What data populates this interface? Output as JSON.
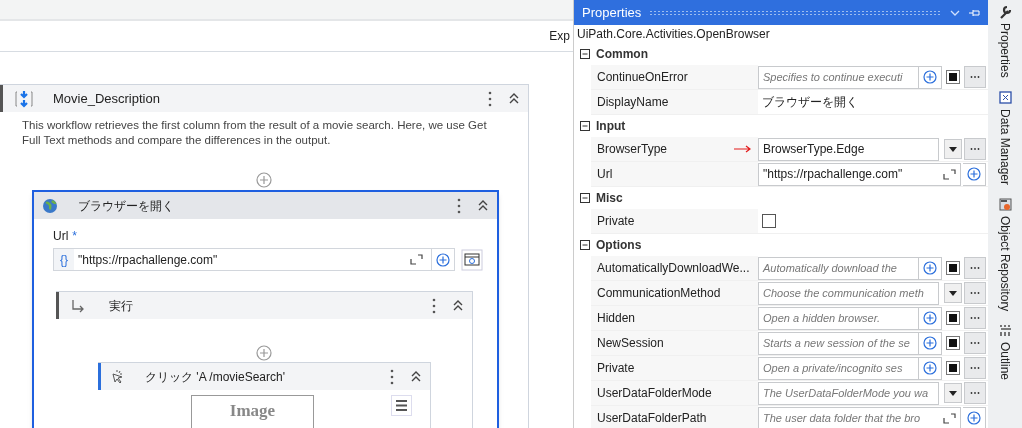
{
  "toolbar": {
    "cut_label": "Exp"
  },
  "sequence": {
    "title": "Movie_Description",
    "description": "This workflow retrieves the first column from the result of a movie search. Here, we use Get Full Text methods and compare the differences in the output.",
    "expanded": true,
    "activity": {
      "title": "ブラウザーを開く",
      "selected": true,
      "url_label": "Url",
      "required_mark": "*",
      "url_value": "\"https://rpachallenge.com\"",
      "expr_mark": "{}",
      "body": {
        "title": "実行",
        "expanded": true,
        "click": {
          "title": "クリック 'A  /movieSearch'",
          "image_text": "Image",
          "expanded": true
        }
      }
    }
  },
  "properties": {
    "title": "Properties",
    "type_name": "UiPath.Core.Activities.OpenBrowser",
    "categories": [
      {
        "name": "Common",
        "expanded": true,
        "rows": [
          {
            "name": "ContinueOnError",
            "kind": "flag",
            "placeholder": "Specifies to continue executi"
          },
          {
            "name": "DisplayName",
            "kind": "text",
            "value": "ブラウザーを開く"
          }
        ]
      },
      {
        "name": "Input",
        "expanded": true,
        "rows": [
          {
            "name": "BrowserType",
            "kind": "enum",
            "value": "BrowserType.Edge",
            "marked": true
          },
          {
            "name": "Url",
            "kind": "expr",
            "value": "\"https://rpachallenge.com\""
          }
        ]
      },
      {
        "name": "Misc",
        "expanded": true,
        "rows": [
          {
            "name": "Private",
            "kind": "checkbox",
            "checked": false
          }
        ]
      },
      {
        "name": "Options",
        "expanded": true,
        "rows": [
          {
            "name": "AutomaticallyDownloadWe...",
            "kind": "flag",
            "placeholder": "Automatically download the"
          },
          {
            "name": "CommunicationMethod",
            "kind": "enum",
            "placeholder": "Choose the communication meth"
          },
          {
            "name": "Hidden",
            "kind": "flag",
            "placeholder": "Open a hidden browser."
          },
          {
            "name": "NewSession",
            "kind": "flag",
            "placeholder": "Starts a new session of the se"
          },
          {
            "name": "Private",
            "kind": "flag",
            "placeholder": "Open a private/incognito ses"
          },
          {
            "name": "UserDataFolderMode",
            "kind": "enum",
            "placeholder": "The UserDataFolderMode you wa"
          },
          {
            "name": "UserDataFolderPath",
            "kind": "expr",
            "placeholder": "The user data folder that the bro"
          }
        ]
      }
    ]
  },
  "side_tabs": [
    {
      "label": "Properties"
    },
    {
      "label": "Data Manager"
    },
    {
      "label": "Object Repository"
    },
    {
      "label": "Outline"
    }
  ]
}
